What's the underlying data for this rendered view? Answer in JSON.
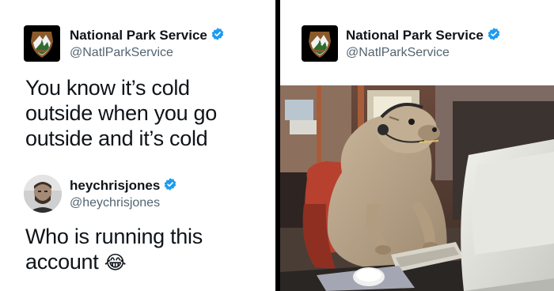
{
  "left": {
    "account": {
      "name": "National Park Service",
      "handle": "@NatlParkService",
      "avatar_icon": "nps-arrowhead-logo-icon",
      "verified_icon": "verified-badge-icon"
    },
    "tweet_lines": [
      "You know it’s cold",
      "outside when you go",
      "outside and it’s cold"
    ],
    "reply": {
      "name": "heychrisjones",
      "handle": "@heychrisjones",
      "avatar_icon": "user-avatar-icon",
      "verified_icon": "verified-badge-icon",
      "lines": [
        "Who is running this",
        "account"
      ],
      "emoji": "😂"
    }
  },
  "right": {
    "account": {
      "name": "National Park Service",
      "handle": "@NatlParkService",
      "avatar_icon": "nps-arrowhead-logo-icon",
      "verified_icon": "verified-badge-icon"
    },
    "media_icon": "prairie-dog-at-computer-photo"
  },
  "colors": {
    "text": "#0f1419",
    "handle": "#536471",
    "verified": "#1d9bf0",
    "divider": "#000000",
    "nps_brown": "#8a5a2b"
  }
}
